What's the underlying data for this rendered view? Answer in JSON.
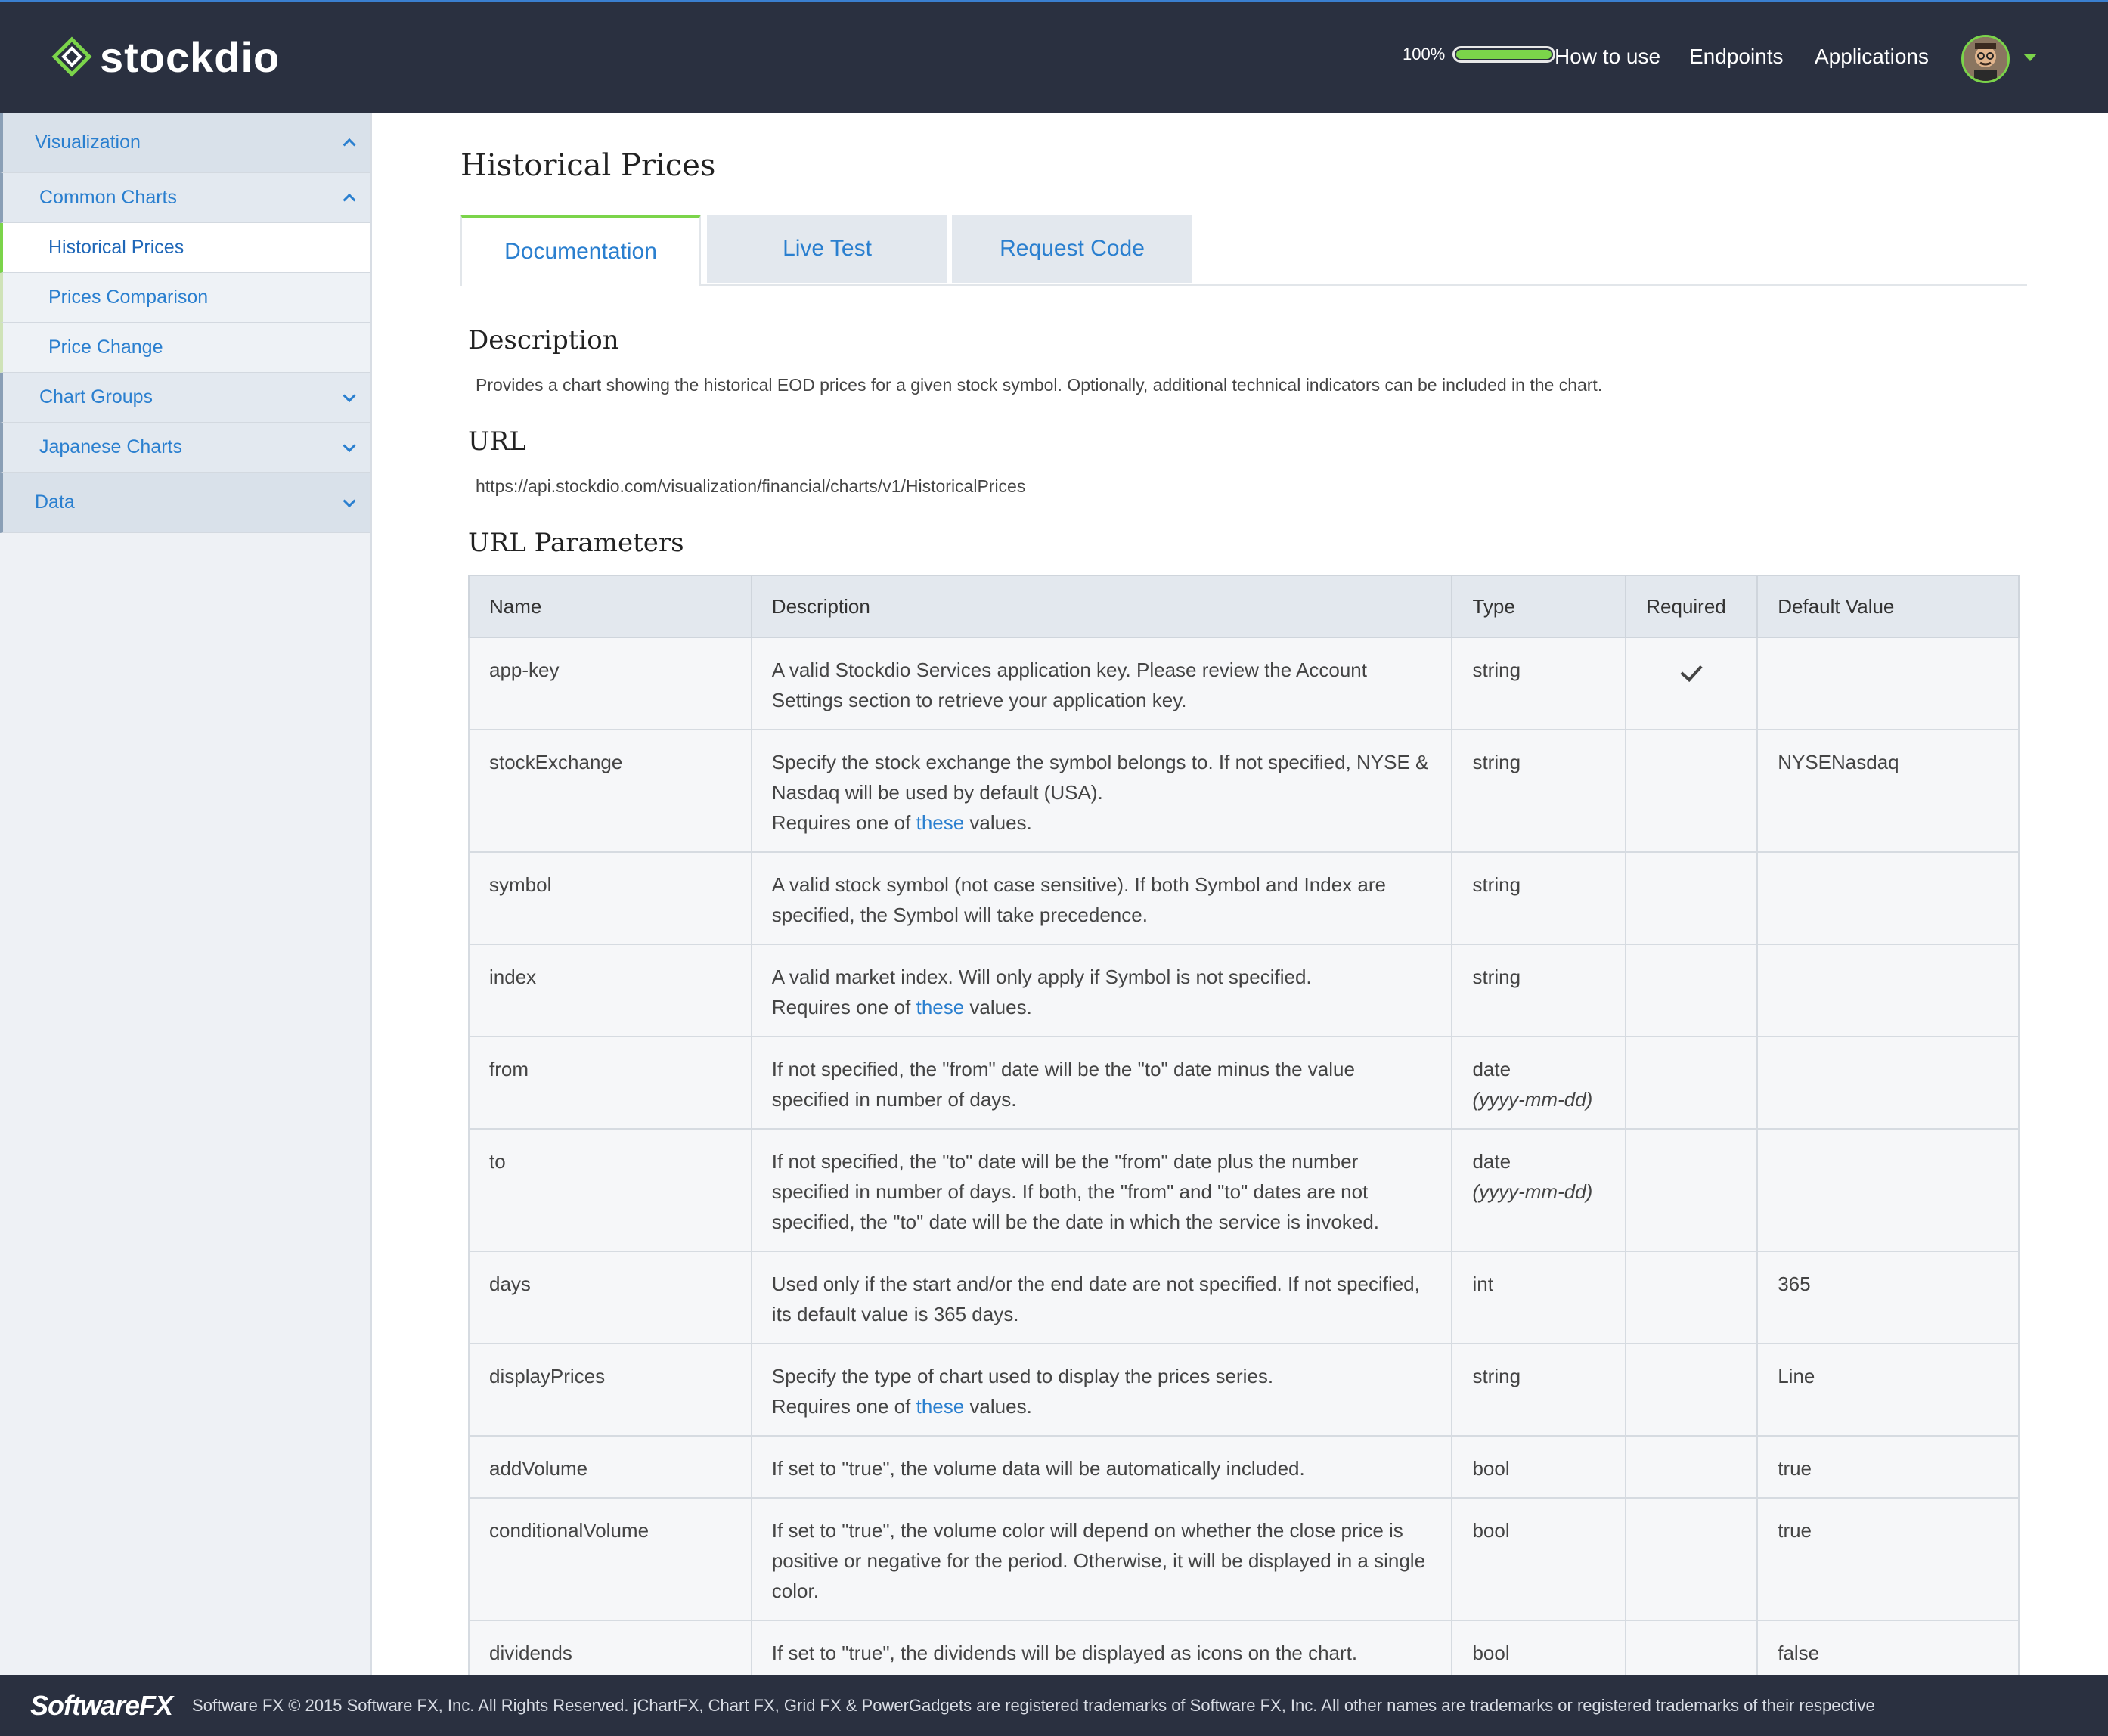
{
  "header": {
    "brand": "stockdio",
    "battery_label": "100%",
    "battery_level": 1.0,
    "nav": [
      "How to use",
      "Endpoints",
      "Applications"
    ],
    "accent_color": "#7bd44a"
  },
  "sidebar": {
    "visualization": "Visualization",
    "common_charts": "Common Charts",
    "historical_prices": "Historical Prices",
    "prices_comparison": "Prices Comparison",
    "price_change": "Price Change",
    "chart_groups": "Chart Groups",
    "japanese_charts": "Japanese Charts",
    "data": "Data"
  },
  "main": {
    "title": "Historical Prices",
    "tabs": [
      "Documentation",
      "Live Test",
      "Request Code"
    ],
    "description_heading": "Description",
    "description_text": "Provides a chart showing the historical EOD prices for a given stock symbol. Optionally, additional technical indicators can be included in the chart.",
    "url_heading": "URL",
    "url_text": "https://api.stockdio.com/visualization/financial/charts/v1/HistoricalPrices",
    "params_heading": "URL Parameters"
  },
  "table": {
    "headers": [
      "Name",
      "Description",
      "Type",
      "Required",
      "Default Value"
    ],
    "link_text": "these",
    "rows": [
      {
        "name": "app-key",
        "d1": "A valid Stockdio Services application key. Please review the Account Settings section to retrieve your application key.",
        "type": "string",
        "type2": "",
        "default": ""
      },
      {
        "name": "stockExchange",
        "d1": "Specify the stock exchange the symbol belongs to. If not specified, NYSE & Nasdaq will be used by default (USA).",
        "d2a": "Requires one of ",
        "d2b": " values.",
        "type": "string",
        "type2": "",
        "default": "NYSENasdaq"
      },
      {
        "name": "symbol",
        "d1": "A valid stock symbol (not case sensitive). If both Symbol and Index are specified, the Symbol will take precedence.",
        "type": "string",
        "type2": "",
        "default": ""
      },
      {
        "name": "index",
        "d1": "A valid market index. Will only apply if Symbol is not specified.",
        "d2a": "Requires one of ",
        "d2b": " values.",
        "type": "string",
        "type2": "",
        "default": ""
      },
      {
        "name": "from",
        "d1": "If not specified, the \"from\" date will be the \"to\" date minus the value specified in number of days.",
        "type": "date",
        "type2": "(yyyy-mm-dd)",
        "default": ""
      },
      {
        "name": "to",
        "d1": "If not specified, the \"to\" date will be the \"from\" date plus the number specified in number of days. If both, the \"from\" and \"to\" dates are not specified, the \"to\" date will be the date in which the service is invoked.",
        "type": "date",
        "type2": "(yyyy-mm-dd)",
        "default": ""
      },
      {
        "name": "days",
        "d1": "Used only if the start and/or the end date are not specified. If not specified, its default value is 365 days.",
        "type": "int",
        "type2": "",
        "default": "365"
      },
      {
        "name": "displayPrices",
        "d1": "Specify the type of chart used to display the prices series.",
        "d2a": "Requires one of ",
        "d2b": " values.",
        "type": "string",
        "type2": "",
        "default": "Line"
      },
      {
        "name": "addVolume",
        "d1": "If set to \"true\", the volume data will be automatically included.",
        "type": "bool",
        "type2": "",
        "default": "true"
      },
      {
        "name": "conditionalVolume",
        "d1": "If set to \"true\", the volume color will depend on whether the close price is positive or negative for the period. Otherwise, it will be displayed in a single color.",
        "type": "bool",
        "type2": "",
        "default": "true"
      },
      {
        "name": "dividends",
        "d1": "If set to \"true\", the dividends will be displayed as icons on the chart.",
        "type": "bool",
        "type2": "",
        "default": "false"
      }
    ]
  },
  "footer": {
    "logo": "SoftwareFX",
    "text": "Software FX © 2015 Software FX, Inc. All Rights Reserved. jChartFX, Chart FX, Grid FX & PowerGadgets are registered trademarks of Software FX, Inc. All other names are trademarks or registered trademarks of their respective"
  }
}
